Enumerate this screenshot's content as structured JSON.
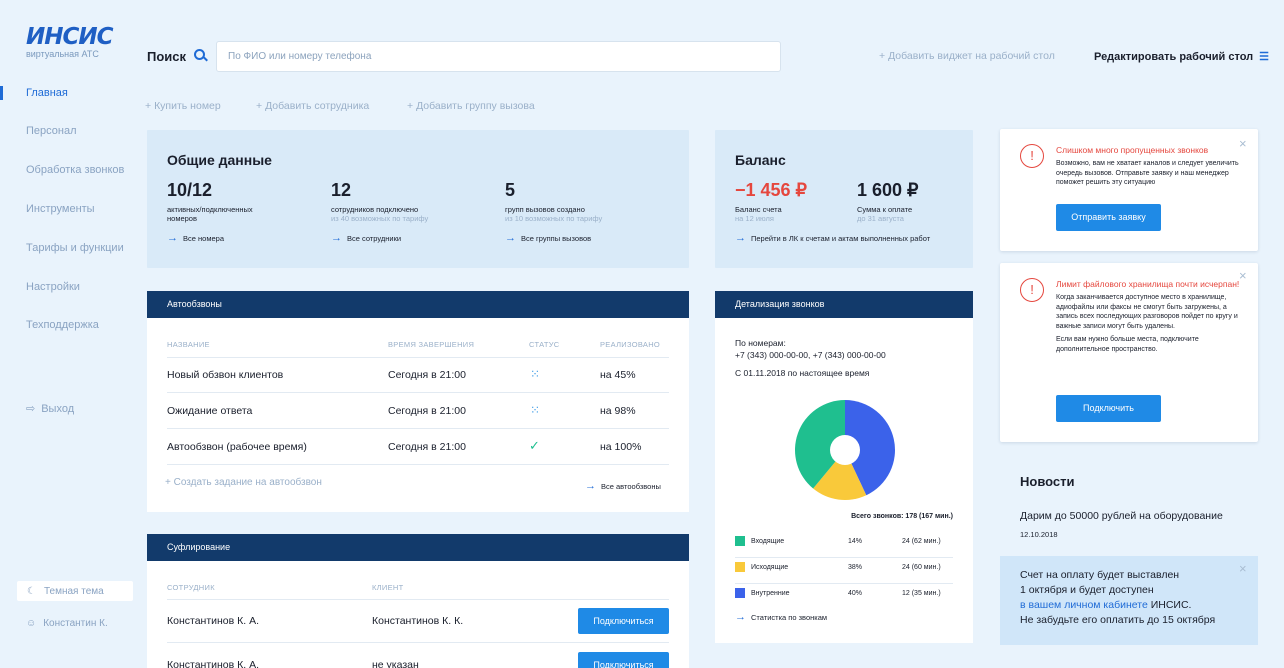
{
  "brand": {
    "logo": "ИНСИС",
    "subtitle": "виртуальная АТС"
  },
  "nav": {
    "items": [
      "Главная",
      "Персонал",
      "Обработка звонков",
      "Инструменты",
      "Тарифы и функции",
      "Настройки",
      "Техподдержка"
    ],
    "logout": "Выход",
    "theme": "Темная тема",
    "user": "Константин К."
  },
  "search": {
    "label": "Поиск",
    "placeholder": "По ФИО или номеру телефона"
  },
  "topbar": {
    "add_widget": "Добавить виджет на рабочий стол",
    "edit_desktop": "Редактировать рабочий стол"
  },
  "quick_actions": [
    "Купить номер",
    "Добавить сотрудника",
    "Добавить группу вызова"
  ],
  "general": {
    "title": "Общие данные",
    "stats": [
      {
        "value": "10/12",
        "label": "активных/подключенных номеров",
        "sub": "",
        "link": "Все номера"
      },
      {
        "value": "12",
        "label": "сотрудников подключено",
        "sub": "из 40 возможных по тарифу",
        "link": "Все сотрудники"
      },
      {
        "value": "5",
        "label": "групп вызовов создано",
        "sub": "из 10 возможных по тарифу",
        "link": "Все группы вызовов"
      }
    ]
  },
  "balance": {
    "title": "Баланс",
    "account": {
      "value": "−1 456 ₽",
      "label": "Баланс счета",
      "sub": "на 12 июля"
    },
    "due": {
      "value": "1 600 ₽",
      "label": "Сумма к оплате",
      "sub": "до 31 августа"
    },
    "link": "Перейти в ЛК к счетам и актам выполненных работ"
  },
  "autodial": {
    "title": "Автообзвоны",
    "headers": [
      "Название",
      "Время завершения",
      "Статус",
      "Реализовано"
    ],
    "rows": [
      {
        "name": "Новый обзвон клиентов",
        "time": "Сегодня в 21:00",
        "status": "loading",
        "done": "на 45%"
      },
      {
        "name": "Ожидание ответа",
        "time": "Сегодня в 21:00",
        "status": "loading",
        "done": "на 98%"
      },
      {
        "name": "Автообзвон (рабочее время)",
        "time": "Сегодня в 21:00",
        "status": "done",
        "done": "на 100%"
      }
    ],
    "create": "Создать задание на автообзвон",
    "all": "Все автообзвоны"
  },
  "prompting": {
    "title": "Суфлирование",
    "headers": [
      "Сотрудник",
      "Клиент"
    ],
    "rows": [
      {
        "employee": "Константинов К. А.",
        "client": "Константинов К. К.",
        "action": "Подключиться"
      },
      {
        "employee": "Константинов К. А.",
        "client": "не указан",
        "action": "Подключиться"
      }
    ]
  },
  "calls": {
    "title": "Детализация звонков",
    "by_numbers_label": "По номерам:",
    "numbers": "+7 (343) 000-00-00, +7 (343) 000-00-00",
    "period": "С 01.11.2018 по настоящее время",
    "total": "Всего звонков: 178 (167 мин.)",
    "link": "Статистка по звонкам"
  },
  "chart_data": {
    "type": "pie",
    "donut": true,
    "series": [
      {
        "name": "Входящие",
        "percent": 14,
        "calls": "24 (62 мин.)",
        "color": "#1fbf8f"
      },
      {
        "name": "Исходящие",
        "percent": 38,
        "calls": "24 (60 мин.)",
        "color": "#f9c93a"
      },
      {
        "name": "Внутренние",
        "percent": 40,
        "calls": "12 (35 мин.)",
        "color": "#3b62ea"
      }
    ],
    "slice_shares": {
      "Внутренние": 0.43,
      "Исходящие": 0.18,
      "Входящие": 0.39
    },
    "legend_placement": "bottom"
  },
  "alerts": [
    {
      "title": "Слишком много пропущенных звонков",
      "text": "Возможно, вам не хватает каналов и следует увеличить очередь вызовов. Отправьте заявку и наш менеджер поможет решить эту ситуацию",
      "button": "Отправить заявку"
    },
    {
      "title": "Лимит файлового хранилища почти исчерпан!",
      "text": "Когда заканчивается доступное место в хранилище, адиофайлы или факсы не смогут быть загружены, а запись всех последующих разговоров пойдет по кругу и важные записи могут быть удалены.",
      "text2": "Если вам нужно больше места, подключите дополнительное пространство.",
      "button": "Подключить"
    }
  ],
  "news": {
    "title": "Новости",
    "item": "Дарим до 50000 рублей на оборудование",
    "date": "12.10.2018",
    "notice_line1": "Счет на оплату будет выставлен",
    "notice_line2": "1 октября и будет доступен",
    "notice_link": "в вашем личном кабинете",
    "notice_brand": "ИНСИС.",
    "notice_line4": "Не забудьте его оплатить до 15 октября"
  },
  "colors": {
    "accent": "#1f6bd6",
    "header": "#123a6b",
    "danger": "#e5473e",
    "button": "#1f8ae6"
  }
}
